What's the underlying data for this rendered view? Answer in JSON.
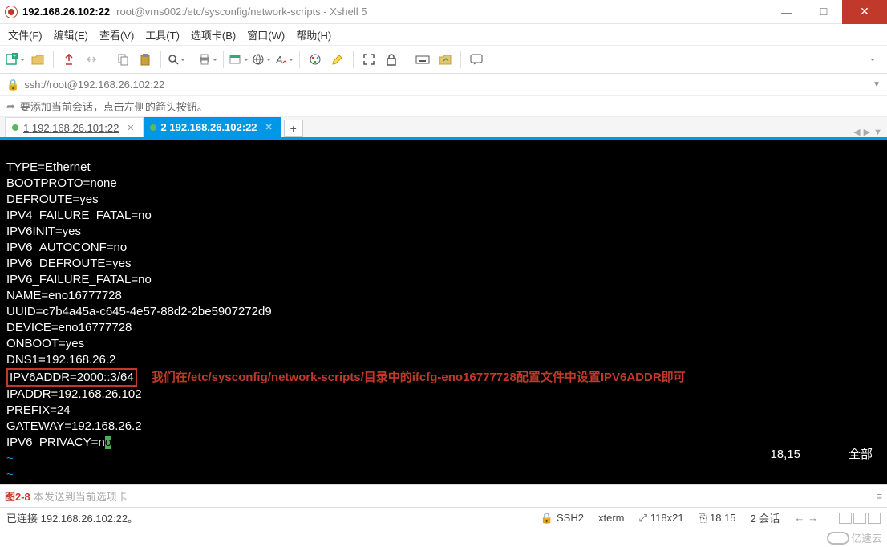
{
  "window": {
    "title_main": "192.168.26.102:22",
    "title_sub": "root@vms002:/etc/sysconfig/network-scripts - Xshell 5"
  },
  "menu": {
    "file": "文件(F)",
    "edit": "编辑(E)",
    "view": "查看(V)",
    "tools": "工具(T)",
    "tabs": "选项卡(B)",
    "window": "窗口(W)",
    "help": "帮助(H)"
  },
  "address": {
    "url": "ssh://root@192.168.26.102:22"
  },
  "hint": {
    "text": "要添加当前会话，点击左侧的箭头按钮。"
  },
  "tabs": {
    "items": [
      {
        "num": "1",
        "label": "192.168.26.101:22",
        "active": false
      },
      {
        "num": "2",
        "label": "192.168.26.102:22",
        "active": true
      }
    ]
  },
  "terminal": {
    "lines": [
      "TYPE=Ethernet",
      "BOOTPROTO=none",
      "DEFROUTE=yes",
      "IPV4_FAILURE_FATAL=no",
      "IPV6INIT=yes",
      "IPV6_AUTOCONF=no",
      "IPV6_DEFROUTE=yes",
      "IPV6_FAILURE_FATAL=no",
      "NAME=eno16777728",
      "UUID=c7b4a45a-c645-4e57-88d2-2be5907272d9",
      "DEVICE=eno16777728",
      "ONBOOT=yes",
      "DNS1=192.168.26.2"
    ],
    "ipv6_line": "IPV6ADDR=2000::3/64",
    "annotation": "我们在/etc/sysconfig/network-scripts/目录中的ifcfg-eno16777728配置文件中设置IPV6ADDR即可",
    "after": [
      "IPADDR=192.168.26.102",
      "PREFIX=24",
      "GATEWAY=192.168.26.2"
    ],
    "privacy_prefix": "IPV6_PRIVACY=n",
    "privacy_cursor": "o",
    "tilde": "~",
    "status_pos": "18,15",
    "status_mode": "全部"
  },
  "sendbar": {
    "figure": "图2-8",
    "hint": "本发送到当前选项卡"
  },
  "status": {
    "connected": "已连接 192.168.26.102:22。",
    "ssh": "SSH2",
    "term": "xterm",
    "size": "118x21",
    "pos": "18,15",
    "sessions": "2 会话"
  },
  "watermark": {
    "text": "亿速云"
  },
  "chart_data": {
    "type": "table",
    "title": "ifcfg-eno16777728",
    "keys": [
      "TYPE",
      "BOOTPROTO",
      "DEFROUTE",
      "IPV4_FAILURE_FATAL",
      "IPV6INIT",
      "IPV6_AUTOCONF",
      "IPV6_DEFROUTE",
      "IPV6_FAILURE_FATAL",
      "NAME",
      "UUID",
      "DEVICE",
      "ONBOOT",
      "DNS1",
      "IPV6ADDR",
      "IPADDR",
      "PREFIX",
      "GATEWAY",
      "IPV6_PRIVACY"
    ],
    "values": [
      "Ethernet",
      "none",
      "yes",
      "no",
      "yes",
      "no",
      "yes",
      "no",
      "eno16777728",
      "c7b4a45a-c645-4e57-88d2-2be5907272d9",
      "eno16777728",
      "yes",
      "192.168.26.2",
      "2000::3/64",
      "192.168.26.102",
      "24",
      "192.168.26.2",
      "no"
    ]
  }
}
